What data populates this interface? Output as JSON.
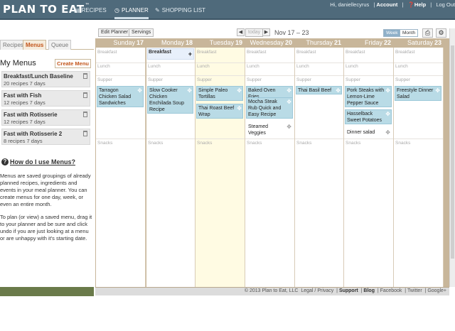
{
  "app": {
    "logo_text": "PLAN TO EAT",
    "logo_mark": "™"
  },
  "nav": {
    "recipes_label": "RECIPES",
    "planner_label": "PLANNER",
    "shopping_label": "SHOPPING LIST"
  },
  "account": {
    "greeting": "Hi, daniellecyrus",
    "account_label": "Account",
    "help_label": "Help",
    "logout_label": "Log Out"
  },
  "sidebar": {
    "tabs": [
      "Recipes",
      "Menus",
      "Queue"
    ],
    "heading": "My Menus",
    "create_label": "Create Menu",
    "menus": [
      {
        "name": "Breakfast/Lunch Baseline",
        "meta": "20 recipes  7 days"
      },
      {
        "name": "Fast with Fish",
        "meta": "12 recipes  7 days"
      },
      {
        "name": "Fast with Rotisserie",
        "meta": "12 recipes  7 days"
      },
      {
        "name": "Fast with Rotisserie 2",
        "meta": "8 recipes  7 days"
      }
    ],
    "howto_title": "How do I use Menus?",
    "para1": "Menus are saved groupings of already planned recipes, ingredients and events in your meal planner. You can create menus for one day, week, or even an entire month.",
    "para2": "To plan (or view) a saved menu, drag it to your planner and be sure and click undo if you are just looking at a menu or are unhappy with it's starting date."
  },
  "toolbar": {
    "edit_planner": "Edit Planner",
    "servings": "Servings",
    "today_label": "today",
    "date_range": "Nov 17 – 23",
    "week_label": "Week",
    "month_label": "Month",
    "prev_icon": "chevron-left-icon",
    "next_icon": "chevron-right-icon"
  },
  "days": [
    {
      "name": "Sunday",
      "num": "17"
    },
    {
      "name": "Monday",
      "num": "18"
    },
    {
      "name": "Tuesday",
      "num": "19"
    },
    {
      "name": "Wednesday",
      "num": "20"
    },
    {
      "name": "Thursday",
      "num": "21"
    },
    {
      "name": "Friday",
      "num": "22"
    },
    {
      "name": "Saturday",
      "num": "23"
    }
  ],
  "slots": {
    "breakfast": "Breakfast",
    "lunch": "Lunch",
    "supper": "Supper",
    "snacks": "Snacks"
  },
  "entries": {
    "monday_breakfast": "Breakfast",
    "sun_s1": "Tarragon Chicken Salad Sandwiches",
    "mon_s1": "Slow Cooker Chicken Enchilada Soup Recipe",
    "tue_s1": "Simple Paleo Tortillas",
    "tue_s2": "Thai Roast Beef Wrap",
    "wed_s1": "Baked Oven Fries",
    "wed_s2": "Mocha Steak Rub Quick and Easy Recipe",
    "wed_s3": "Steamed Veggies",
    "thu_s1": "Thai Basil Beef",
    "fri_s1": "Pork Steaks with Lemon-Lime Pepper Sauce",
    "fri_s2": "Hasselback Sweet Potatoes",
    "fri_s3": "Dinner salad",
    "sat_s1": "Freestyle Dinner Salad"
  },
  "footer": {
    "copyright": "© 2013 Plan to Eat, LLC",
    "legal": "Legal / Privacy",
    "support": "Support",
    "blog": "Blog",
    "facebook": "Facebook",
    "twitter": "Twitter",
    "google": "Google+"
  }
}
